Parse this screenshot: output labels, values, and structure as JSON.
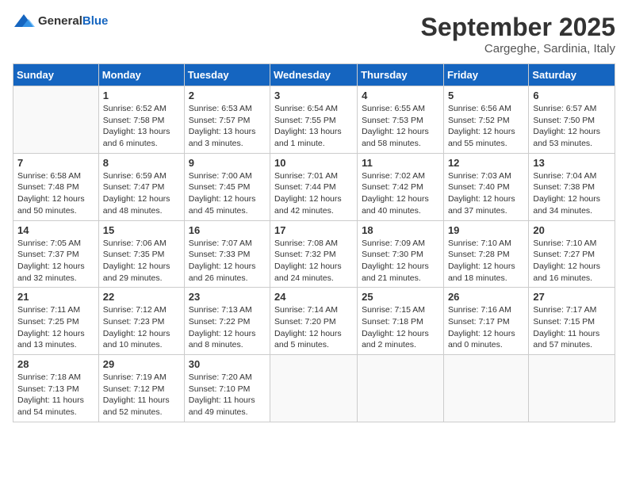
{
  "logo": {
    "general": "General",
    "blue": "Blue"
  },
  "header": {
    "month": "September 2025",
    "location": "Cargeghe, Sardinia, Italy"
  },
  "weekdays": [
    "Sunday",
    "Monday",
    "Tuesday",
    "Wednesday",
    "Thursday",
    "Friday",
    "Saturday"
  ],
  "weeks": [
    [
      {
        "day": "",
        "info": ""
      },
      {
        "day": "1",
        "info": "Sunrise: 6:52 AM\nSunset: 7:58 PM\nDaylight: 13 hours\nand 6 minutes."
      },
      {
        "day": "2",
        "info": "Sunrise: 6:53 AM\nSunset: 7:57 PM\nDaylight: 13 hours\nand 3 minutes."
      },
      {
        "day": "3",
        "info": "Sunrise: 6:54 AM\nSunset: 7:55 PM\nDaylight: 13 hours\nand 1 minute."
      },
      {
        "day": "4",
        "info": "Sunrise: 6:55 AM\nSunset: 7:53 PM\nDaylight: 12 hours\nand 58 minutes."
      },
      {
        "day": "5",
        "info": "Sunrise: 6:56 AM\nSunset: 7:52 PM\nDaylight: 12 hours\nand 55 minutes."
      },
      {
        "day": "6",
        "info": "Sunrise: 6:57 AM\nSunset: 7:50 PM\nDaylight: 12 hours\nand 53 minutes."
      }
    ],
    [
      {
        "day": "7",
        "info": "Sunrise: 6:58 AM\nSunset: 7:48 PM\nDaylight: 12 hours\nand 50 minutes."
      },
      {
        "day": "8",
        "info": "Sunrise: 6:59 AM\nSunset: 7:47 PM\nDaylight: 12 hours\nand 48 minutes."
      },
      {
        "day": "9",
        "info": "Sunrise: 7:00 AM\nSunset: 7:45 PM\nDaylight: 12 hours\nand 45 minutes."
      },
      {
        "day": "10",
        "info": "Sunrise: 7:01 AM\nSunset: 7:44 PM\nDaylight: 12 hours\nand 42 minutes."
      },
      {
        "day": "11",
        "info": "Sunrise: 7:02 AM\nSunset: 7:42 PM\nDaylight: 12 hours\nand 40 minutes."
      },
      {
        "day": "12",
        "info": "Sunrise: 7:03 AM\nSunset: 7:40 PM\nDaylight: 12 hours\nand 37 minutes."
      },
      {
        "day": "13",
        "info": "Sunrise: 7:04 AM\nSunset: 7:38 PM\nDaylight: 12 hours\nand 34 minutes."
      }
    ],
    [
      {
        "day": "14",
        "info": "Sunrise: 7:05 AM\nSunset: 7:37 PM\nDaylight: 12 hours\nand 32 minutes."
      },
      {
        "day": "15",
        "info": "Sunrise: 7:06 AM\nSunset: 7:35 PM\nDaylight: 12 hours\nand 29 minutes."
      },
      {
        "day": "16",
        "info": "Sunrise: 7:07 AM\nSunset: 7:33 PM\nDaylight: 12 hours\nand 26 minutes."
      },
      {
        "day": "17",
        "info": "Sunrise: 7:08 AM\nSunset: 7:32 PM\nDaylight: 12 hours\nand 24 minutes."
      },
      {
        "day": "18",
        "info": "Sunrise: 7:09 AM\nSunset: 7:30 PM\nDaylight: 12 hours\nand 21 minutes."
      },
      {
        "day": "19",
        "info": "Sunrise: 7:10 AM\nSunset: 7:28 PM\nDaylight: 12 hours\nand 18 minutes."
      },
      {
        "day": "20",
        "info": "Sunrise: 7:10 AM\nSunset: 7:27 PM\nDaylight: 12 hours\nand 16 minutes."
      }
    ],
    [
      {
        "day": "21",
        "info": "Sunrise: 7:11 AM\nSunset: 7:25 PM\nDaylight: 12 hours\nand 13 minutes."
      },
      {
        "day": "22",
        "info": "Sunrise: 7:12 AM\nSunset: 7:23 PM\nDaylight: 12 hours\nand 10 minutes."
      },
      {
        "day": "23",
        "info": "Sunrise: 7:13 AM\nSunset: 7:22 PM\nDaylight: 12 hours\nand 8 minutes."
      },
      {
        "day": "24",
        "info": "Sunrise: 7:14 AM\nSunset: 7:20 PM\nDaylight: 12 hours\nand 5 minutes."
      },
      {
        "day": "25",
        "info": "Sunrise: 7:15 AM\nSunset: 7:18 PM\nDaylight: 12 hours\nand 2 minutes."
      },
      {
        "day": "26",
        "info": "Sunrise: 7:16 AM\nSunset: 7:17 PM\nDaylight: 12 hours\nand 0 minutes."
      },
      {
        "day": "27",
        "info": "Sunrise: 7:17 AM\nSunset: 7:15 PM\nDaylight: 11 hours\nand 57 minutes."
      }
    ],
    [
      {
        "day": "28",
        "info": "Sunrise: 7:18 AM\nSunset: 7:13 PM\nDaylight: 11 hours\nand 54 minutes."
      },
      {
        "day": "29",
        "info": "Sunrise: 7:19 AM\nSunset: 7:12 PM\nDaylight: 11 hours\nand 52 minutes."
      },
      {
        "day": "30",
        "info": "Sunrise: 7:20 AM\nSunset: 7:10 PM\nDaylight: 11 hours\nand 49 minutes."
      },
      {
        "day": "",
        "info": ""
      },
      {
        "day": "",
        "info": ""
      },
      {
        "day": "",
        "info": ""
      },
      {
        "day": "",
        "info": ""
      }
    ]
  ]
}
